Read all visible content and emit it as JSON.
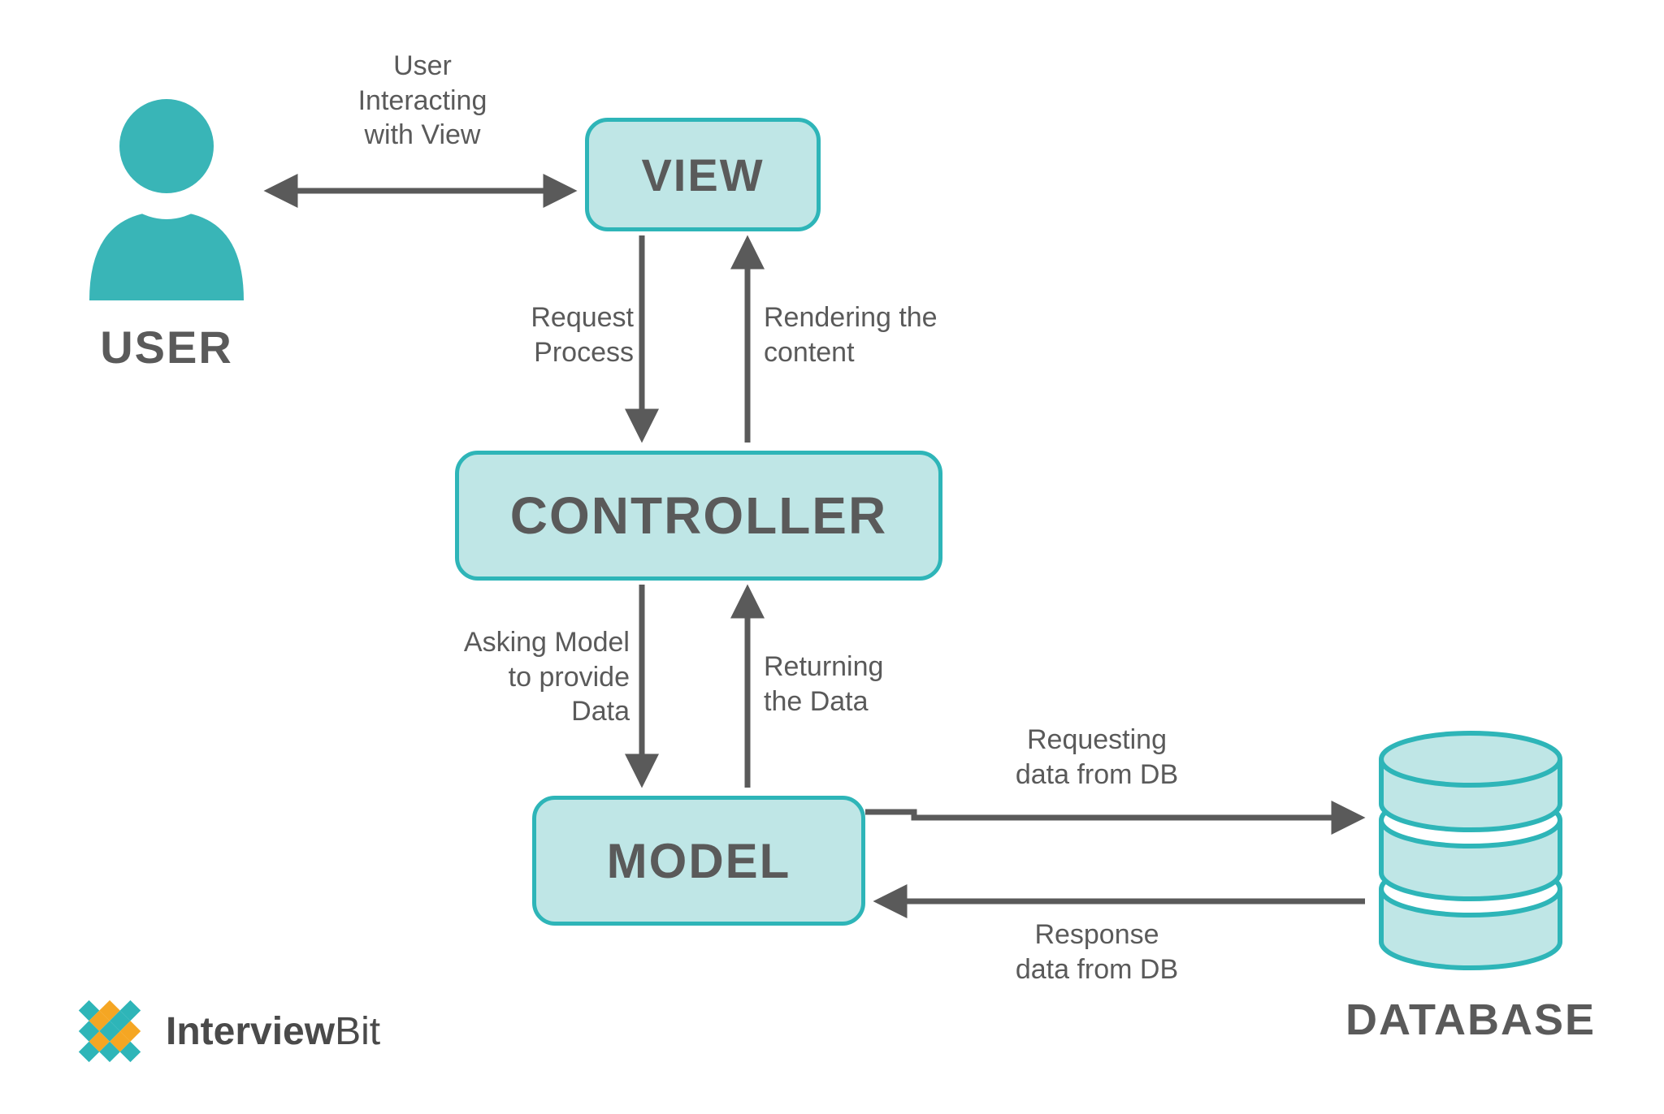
{
  "nodes": {
    "view": "VIEW",
    "controller": "CONTROLLER",
    "model": "MODEL",
    "user": "USER",
    "database": "DATABASE"
  },
  "edges": {
    "user_view": "User\nInteracting\nwith View",
    "view_controller_request": "Request\nProcess",
    "controller_view_render": "Rendering the\ncontent",
    "controller_model_ask": "Asking Model\nto provide\nData",
    "model_controller_return": "Returning\nthe Data",
    "model_db_request": "Requesting\ndata from DB",
    "db_model_response": "Response\ndata from DB"
  },
  "logo": {
    "part1": "Interview",
    "part2": "Bit"
  },
  "colors": {
    "box_fill": "#bfe6e6",
    "box_border": "#2eb5b8",
    "text": "#5a5a5a",
    "user_icon": "#39b5b7",
    "db_fill": "#bfe6e6",
    "db_stroke": "#2eb5b8"
  }
}
